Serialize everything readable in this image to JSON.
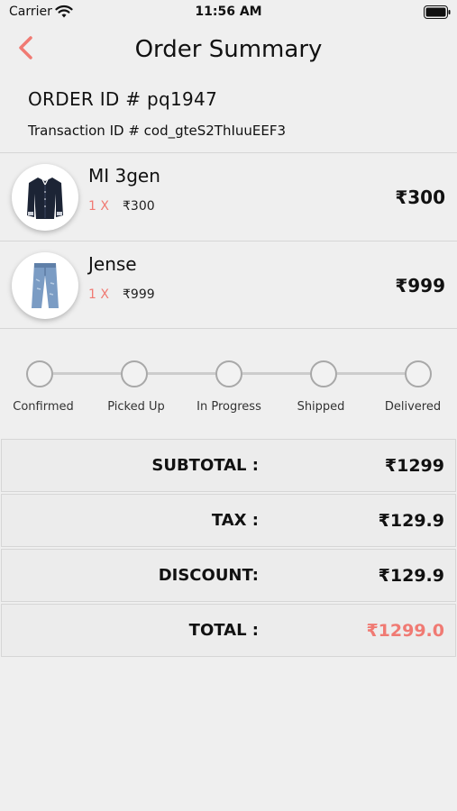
{
  "status_bar": {
    "carrier": "Carrier",
    "time": "11:56 AM"
  },
  "header": {
    "title": "Order Summary",
    "back_icon": "chevron-left-icon",
    "accent_color": "#f07a73"
  },
  "order": {
    "order_id": "ORDER ID # pq1947",
    "transaction_id": "Transaction ID # cod_gteS2ThIuuEEF3"
  },
  "items": [
    {
      "name": "MI 3gen",
      "qty": "1 X",
      "unit_price": "₹300",
      "total": "₹300",
      "icon": "shirt-icon"
    },
    {
      "name": "Jense",
      "qty": "1 X",
      "unit_price": "₹999",
      "total": "₹999",
      "icon": "jeans-icon"
    }
  ],
  "tracker": {
    "steps": [
      "Confirmed",
      "Picked Up",
      "In Progress",
      "Shipped",
      "Delivered"
    ]
  },
  "summary": {
    "rows": [
      {
        "label": "SUBTOTAL :",
        "value": "₹1299"
      },
      {
        "label": "TAX :",
        "value": "₹129.9"
      },
      {
        "label": "DISCOUNT:",
        "value": "₹129.9"
      },
      {
        "label": "TOTAL :",
        "value": "₹1299.0"
      }
    ]
  }
}
